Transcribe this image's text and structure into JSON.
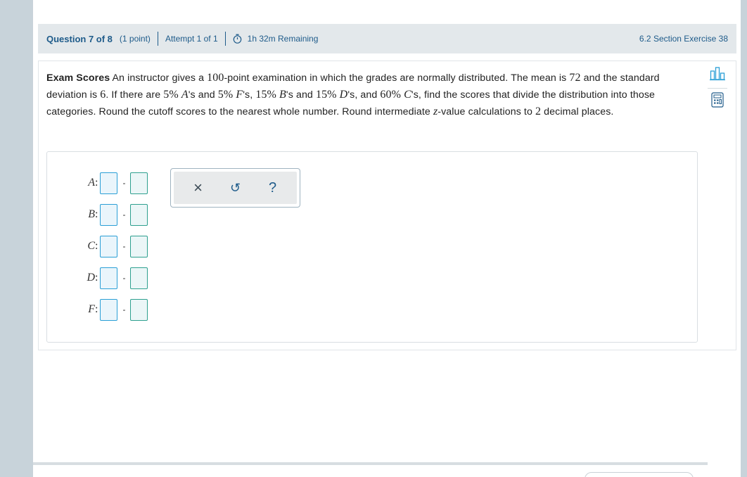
{
  "header": {
    "question_label": "Question 7 of 8",
    "points": "(1 point)",
    "attempt": "Attempt 1 of 1",
    "time_remaining": "1h 32m Remaining",
    "section_ref": "6.2 Section Exercise 38"
  },
  "problem": {
    "title": "Exam Scores",
    "t1": " An instructor gives a ",
    "n_100": "100",
    "t2": "-point examination in which the grades are normally distributed. The mean is ",
    "mean": "72",
    "t3": " and the standard deviation is ",
    "sd": "6",
    "t4": ". If there are ",
    "pa": "5%",
    "la": "A",
    "t5": "'s and ",
    "pf": "5%",
    "lf": "F",
    "t6": "'s, ",
    "pb": "15%",
    "lb": "B",
    "t7": "'s and ",
    "pd": "15%",
    "ld": "D",
    "t8": "'s, and ",
    "pc": "60%",
    "lc": "C",
    "t9": "'s, find the scores that divide the distribution into those categories. Round the cutoff scores to the nearest whole number. Round intermediate ",
    "z": "z",
    "t10": "-value calculations to ",
    "n_2": "2",
    "t11": " decimal places."
  },
  "answers": {
    "rows": [
      {
        "label": "A",
        "colon": ":",
        "dash": "-",
        "low": "",
        "high": ""
      },
      {
        "label": "B",
        "colon": ":",
        "dash": "-",
        "low": "",
        "high": ""
      },
      {
        "label": "C",
        "colon": ":",
        "dash": "-",
        "low": "",
        "high": ""
      },
      {
        "label": "D",
        "colon": ":",
        "dash": "-",
        "low": "",
        "high": ""
      },
      {
        "label": "F",
        "colon": ":",
        "dash": "-",
        "low": "",
        "high": ""
      }
    ]
  },
  "toolbar": {
    "clear_glyph": "×",
    "undo_glyph": "↺",
    "help_glyph": "?"
  },
  "icons": {
    "timer": "stopwatch-icon",
    "stats": "bar-chart-icon",
    "calculator": "calculator-icon"
  },
  "colors": {
    "accent": "#1e5b8a",
    "input_border": "#2a9fd6",
    "header_bg": "#e3e8eb"
  }
}
